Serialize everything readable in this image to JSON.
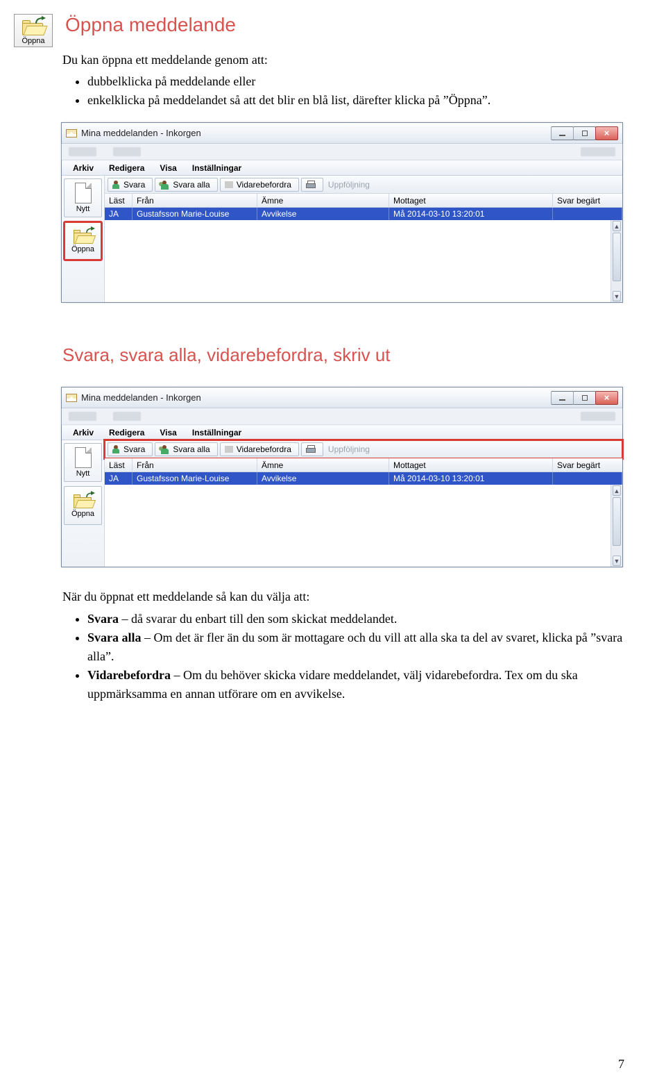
{
  "intro": {
    "open_btn_label": "Öppna",
    "title": "Öppna meddelande",
    "lead": "Du kan öppna ett meddelande genom att:",
    "bullets": [
      "dubbelklicka på meddelande eller",
      "enkelklicka på meddelandet så att det blir en blå list, därefter klicka på ”Öppna”."
    ]
  },
  "section2_title": "Svara, svara alla, vidarebefordra, skriv ut",
  "after_lead": "När du öppnat ett meddelande så kan du välja att:",
  "after_bullets": [
    {
      "b": "Svara",
      "rest": " – då svarar du enbart till den som skickat meddelandet."
    },
    {
      "b": "Svara alla",
      "rest": " – Om det är fler än du som är mottagare och du vill att alla ska ta del av svaret, klicka på ”svara alla”."
    },
    {
      "b": "Vidarebefordra",
      "rest": " – Om du behöver skicka vidare meddelandet, välj vidarebefordra. Tex om du ska uppmärksamma en annan utförare om en avvikelse."
    }
  ],
  "app": {
    "title": "Mina meddelanden - Inkorgen",
    "menus": [
      "Arkiv",
      "Redigera",
      "Visa",
      "Inställningar"
    ],
    "left_buttons": {
      "nytt": "Nytt",
      "oppna": "Öppna"
    },
    "toolbar": {
      "svara": "Svara",
      "svara_alla": "Svara alla",
      "vidare": "Vidarebefordra",
      "uppf": "Uppföljning"
    },
    "columns": {
      "last": "Läst",
      "fran": "Från",
      "amne": "Ämne",
      "mottaget": "Mottaget",
      "svar": "Svar begärt"
    },
    "row": {
      "last": "JA",
      "fran": "Gustafsson Marie-Louise",
      "amne": "Avvikelse",
      "mottaget": "Må 2014-03-10 13:20:01",
      "svar": ""
    }
  },
  "page_number": "7"
}
